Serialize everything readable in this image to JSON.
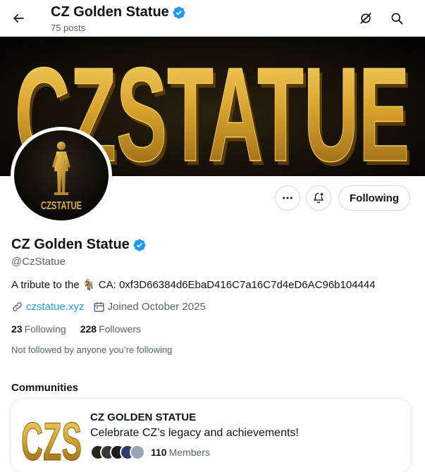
{
  "header": {
    "title": "CZ Golden Statue",
    "posts": "75 posts"
  },
  "banner": {
    "text": "CZSTATUE"
  },
  "avatar": {
    "label": "CZSTATUE"
  },
  "actions": {
    "following_label": "Following"
  },
  "profile": {
    "name": "CZ Golden Statue",
    "handle": "@CzStatue",
    "bio_prefix": "A tribute to the",
    "bio_emoji": "🐐",
    "bio_suffix": "CA: 0xf3D66384d6EbaD416C7a16C7d4eD6AC96b104444",
    "website": "czstatue.xyz",
    "joined": "Joined October 2025",
    "following_count": "23",
    "following_label": "Following",
    "followers_count": "228",
    "followers_label": "Followers",
    "not_followed": "Not followed by anyone you’re following"
  },
  "communities": {
    "title": "Communities",
    "card": {
      "logo_text": "CZS",
      "name": "CZ GOLDEN STATUE",
      "description": "Celebrate CZ’s legacy and achievements!",
      "member_count": "110",
      "member_label": "Members"
    }
  },
  "colors": {
    "accent": "#1d9bf0",
    "gold": "#d4a52a",
    "text": "#0f1419",
    "muted": "#536471"
  }
}
